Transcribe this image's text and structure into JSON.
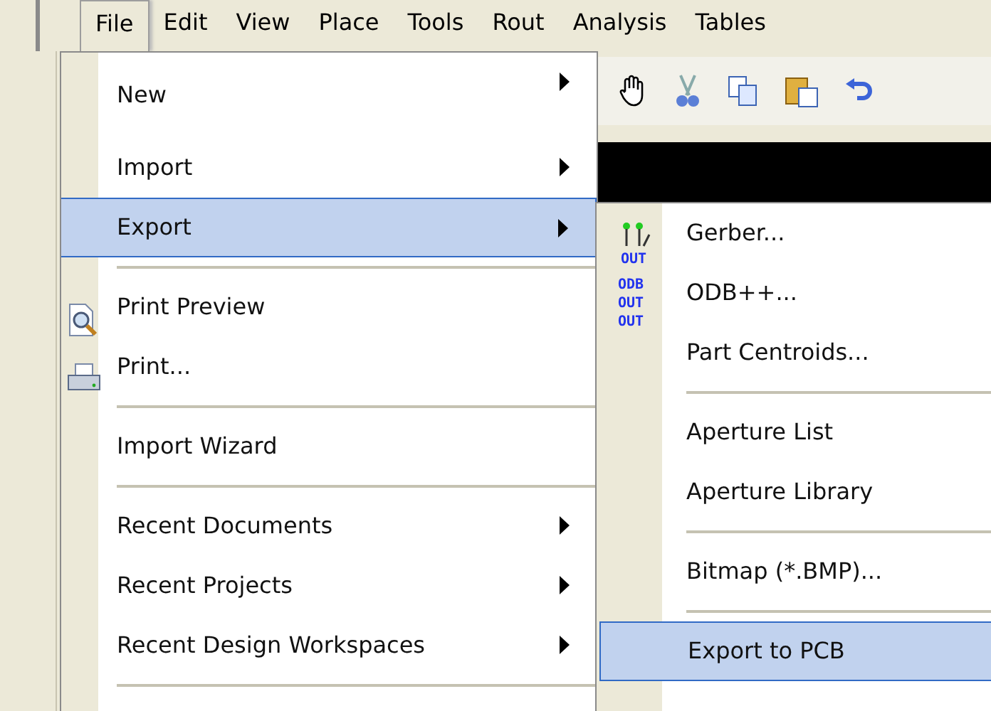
{
  "menu_bar": [
    {
      "label": "File",
      "selected": true
    },
    {
      "label": "Edit",
      "selected": false
    },
    {
      "label": "View",
      "selected": false
    },
    {
      "label": "Place",
      "selected": false
    },
    {
      "label": "Tools",
      "selected": false
    },
    {
      "label": "Rout",
      "selected": false
    },
    {
      "label": "Analysis",
      "selected": false
    },
    {
      "label": "Tables",
      "selected": false
    }
  ],
  "file_menu": {
    "items": [
      {
        "kind": "item",
        "label": "New",
        "submenu": true,
        "selected": false
      },
      {
        "kind": "item",
        "label": "Import",
        "submenu": true,
        "selected": false
      },
      {
        "kind": "item",
        "label": "Export",
        "submenu": true,
        "selected": true
      },
      {
        "kind": "separator"
      },
      {
        "kind": "preview",
        "label": "Print Preview",
        "submenu": false,
        "selected": false
      },
      {
        "kind": "print",
        "label": "Print...",
        "submenu": false,
        "selected": false
      },
      {
        "kind": "separator"
      },
      {
        "kind": "item",
        "label": "Import Wizard",
        "submenu": false,
        "selected": false
      },
      {
        "kind": "separator"
      },
      {
        "kind": "item",
        "label": "Recent Documents",
        "submenu": true,
        "selected": false
      },
      {
        "kind": "item",
        "label": "Recent Projects",
        "submenu": true,
        "selected": false
      },
      {
        "kind": "item",
        "label": "Recent Design Workspaces",
        "submenu": true,
        "selected": false
      },
      {
        "kind": "separator"
      }
    ]
  },
  "export_menu": {
    "items": [
      {
        "kind": "gerber",
        "label": "Gerber...",
        "selected": false,
        "icon_text": [
          "OUT"
        ]
      },
      {
        "kind": "odb",
        "label": "ODB++...",
        "selected": false,
        "icon_text": [
          "ODB",
          "OUT",
          "OUT"
        ]
      },
      {
        "kind": "item",
        "label": "Part Centroids...",
        "selected": false
      },
      {
        "kind": "separator"
      },
      {
        "kind": "item",
        "label": "Aperture List",
        "selected": false
      },
      {
        "kind": "item",
        "label": "Aperture Library",
        "selected": false
      },
      {
        "kind": "separator"
      },
      {
        "kind": "item",
        "label": "Bitmap (*.BMP)...",
        "selected": false
      },
      {
        "kind": "separator"
      },
      {
        "kind": "item",
        "label": "Export to PCB",
        "selected": true
      }
    ]
  }
}
